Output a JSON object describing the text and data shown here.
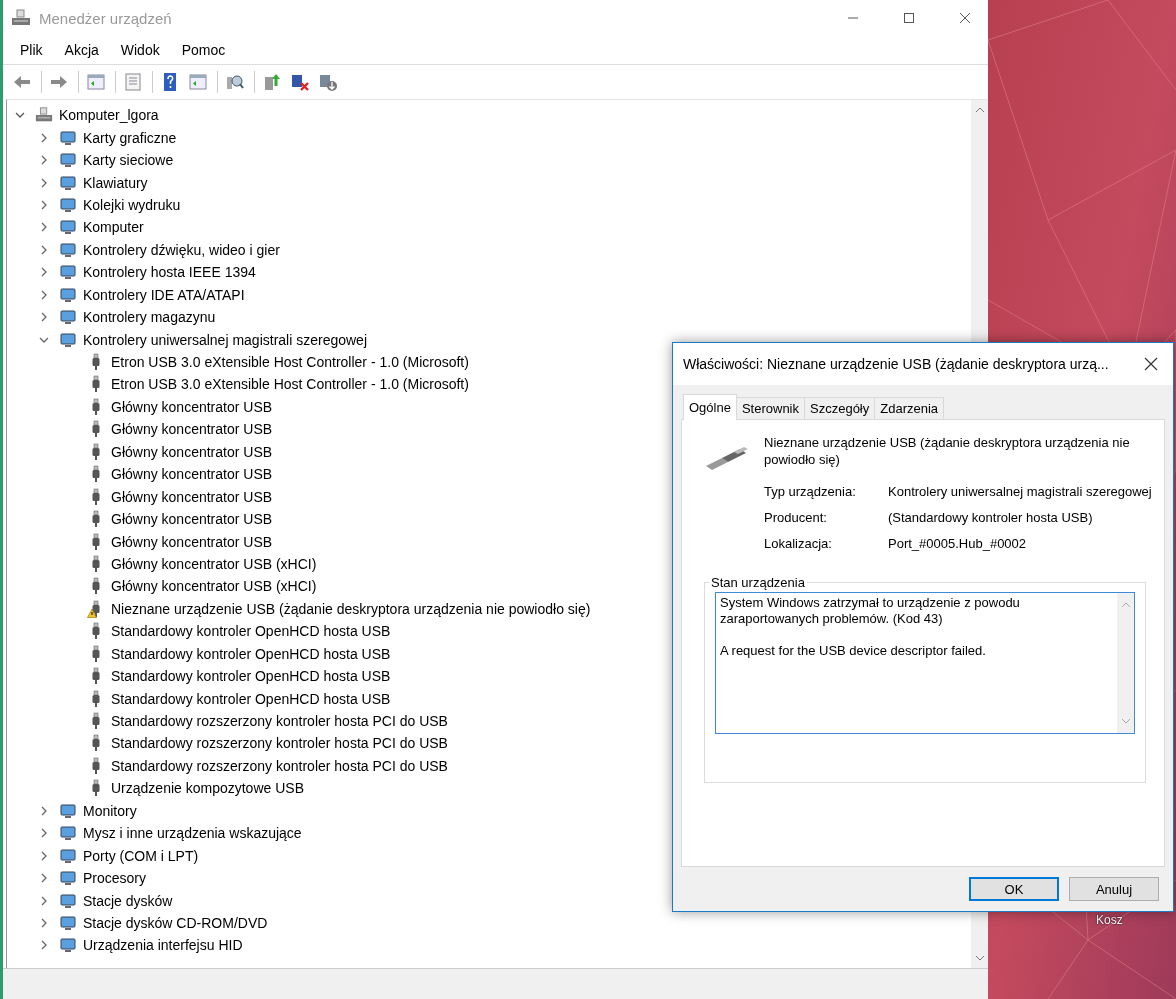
{
  "window": {
    "title": "Menedżer urządzeń"
  },
  "menu": [
    "Plik",
    "Akcja",
    "Widok",
    "Pomoc"
  ],
  "tree": {
    "label": "Komputer_lgora",
    "expanded": true,
    "children": [
      {
        "label": "Karty graficzne",
        "expanded": false
      },
      {
        "label": "Karty sieciowe",
        "expanded": false
      },
      {
        "label": "Klawiatury",
        "expanded": false
      },
      {
        "label": "Kolejki wydruku",
        "expanded": false
      },
      {
        "label": "Komputer",
        "expanded": false
      },
      {
        "label": "Kontrolery dźwięku, wideo i gier",
        "expanded": false
      },
      {
        "label": "Kontrolery hosta IEEE 1394",
        "expanded": false
      },
      {
        "label": "Kontrolery IDE ATA/ATAPI",
        "expanded": false
      },
      {
        "label": "Kontrolery magazynu",
        "expanded": false
      },
      {
        "label": "Kontrolery uniwersalnej magistrali szeregowej",
        "expanded": true,
        "children": [
          {
            "label": "Etron USB 3.0 eXtensible Host Controller - 1.0 (Microsoft)",
            "warning": false
          },
          {
            "label": "Etron USB 3.0 eXtensible Host Controller - 1.0 (Microsoft)",
            "warning": false
          },
          {
            "label": "Główny koncentrator USB",
            "warning": false
          },
          {
            "label": "Główny koncentrator USB",
            "warning": false
          },
          {
            "label": "Główny koncentrator USB",
            "warning": false
          },
          {
            "label": "Główny koncentrator USB",
            "warning": false
          },
          {
            "label": "Główny koncentrator USB",
            "warning": false
          },
          {
            "label": "Główny koncentrator USB",
            "warning": false
          },
          {
            "label": "Główny koncentrator USB",
            "warning": false
          },
          {
            "label": "Główny koncentrator USB (xHCI)",
            "warning": false
          },
          {
            "label": "Główny koncentrator USB (xHCI)",
            "warning": false
          },
          {
            "label": "Nieznane urządzenie USB (żądanie deskryptora urządzenia nie powiodło się)",
            "warning": true
          },
          {
            "label": "Standardowy kontroler OpenHCD hosta USB",
            "warning": false
          },
          {
            "label": "Standardowy kontroler OpenHCD hosta USB",
            "warning": false
          },
          {
            "label": "Standardowy kontroler OpenHCD hosta USB",
            "warning": false
          },
          {
            "label": "Standardowy kontroler OpenHCD hosta USB",
            "warning": false
          },
          {
            "label": "Standardowy rozszerzony kontroler hosta PCI do USB",
            "warning": false
          },
          {
            "label": "Standardowy rozszerzony kontroler hosta PCI do USB",
            "warning": false
          },
          {
            "label": "Standardowy rozszerzony kontroler hosta PCI do USB",
            "warning": false
          },
          {
            "label": "Urządzenie kompozytowe USB",
            "warning": false
          }
        ]
      },
      {
        "label": "Monitory",
        "expanded": false
      },
      {
        "label": "Mysz i inne urządzenia wskazujące",
        "expanded": false
      },
      {
        "label": "Porty (COM i LPT)",
        "expanded": false
      },
      {
        "label": "Procesory",
        "expanded": false
      },
      {
        "label": "Stacje dysków",
        "expanded": false
      },
      {
        "label": "Stacje dysków CD-ROM/DVD",
        "expanded": false
      },
      {
        "label": "Urządzenia interfejsu HID",
        "expanded": false
      }
    ]
  },
  "desktop": {
    "icon_label": "Kosz"
  },
  "dialog": {
    "title": "Właściwości: Nieznane urządzenie USB (żądanie deskryptora urzą...",
    "tabs": [
      {
        "label": "Ogólne",
        "selected": true
      },
      {
        "label": "Sterownik",
        "selected": false
      },
      {
        "label": "Szczegóły",
        "selected": false
      },
      {
        "label": "Zdarzenia",
        "selected": false
      }
    ],
    "device_name": "Nieznane urządzenie USB (żądanie deskryptora urządzenia nie powiodło się)",
    "properties": [
      {
        "label": "Typ urządzenia:",
        "value": "Kontrolery uniwersalnej magistrali szeregowej"
      },
      {
        "label": "Producent:",
        "value": "(Standardowy kontroler hosta USB)"
      },
      {
        "label": "Lokalizacja:",
        "value": "Port_#0005.Hub_#0002"
      }
    ],
    "status_group": "Stan urządzenia",
    "status_text": [
      "System Windows zatrzymał to urządzenie z powodu zaraportowanych problemów. (Kod 43)",
      "A request for the USB device descriptor failed."
    ],
    "buttons": [
      "OK",
      "Anuluj"
    ]
  }
}
